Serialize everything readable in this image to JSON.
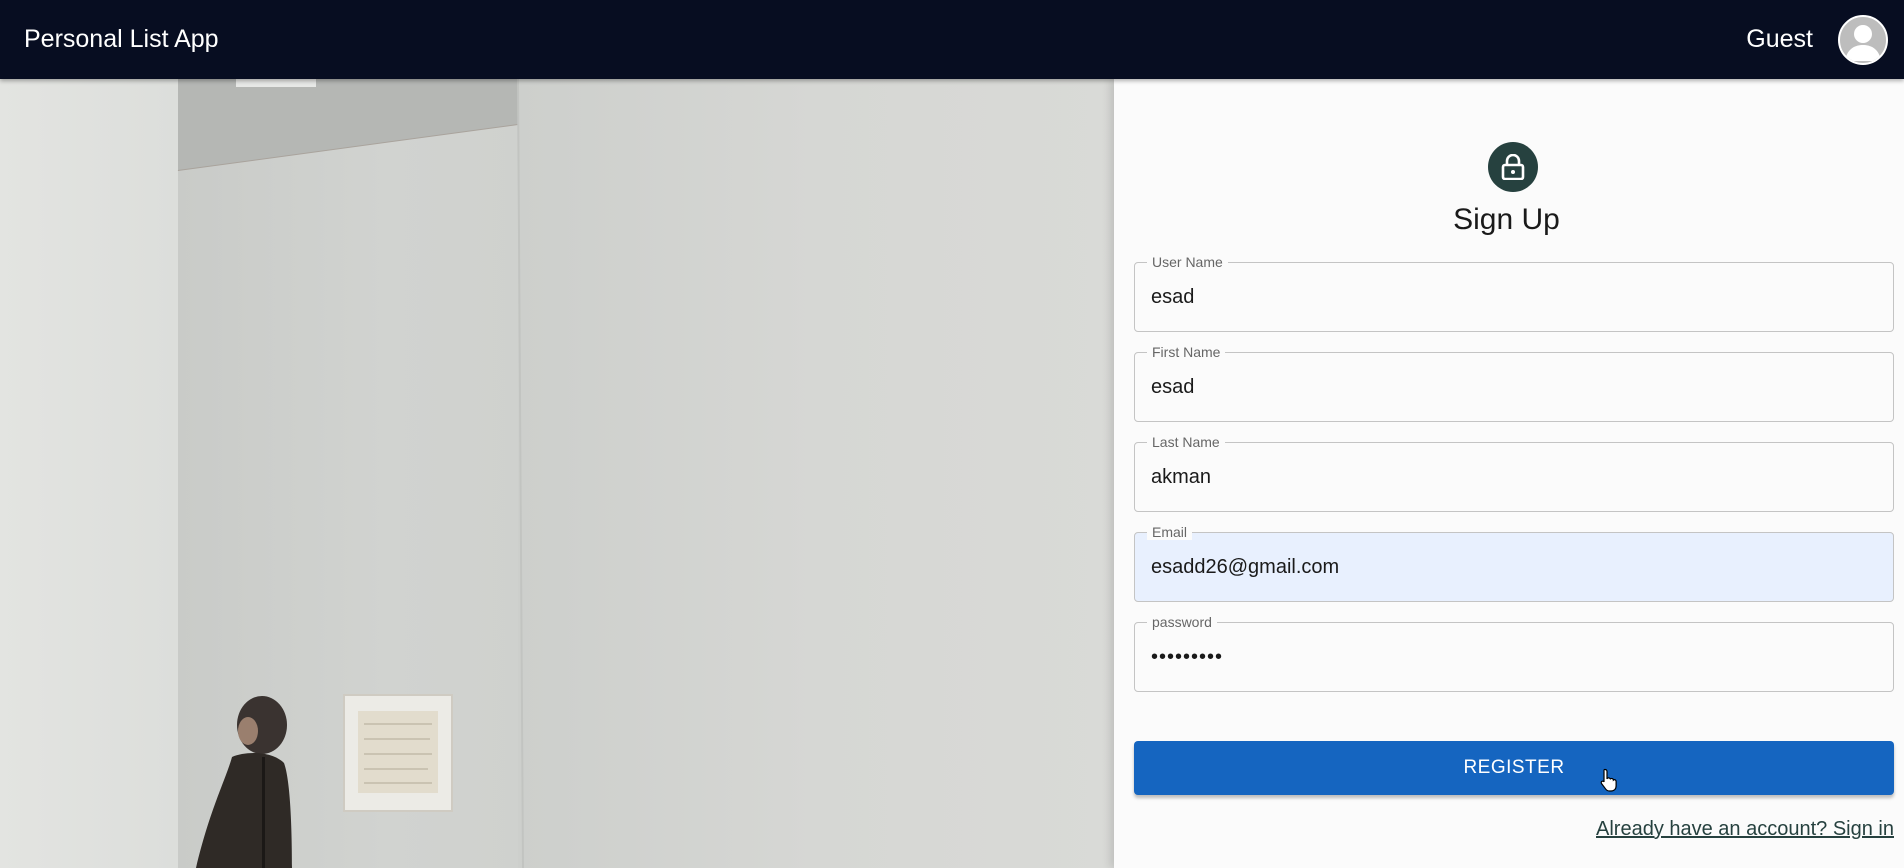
{
  "appbar": {
    "title": "Personal List App",
    "user_label": "Guest",
    "avatar_icon": "account-circle-icon",
    "background": "#070d21"
  },
  "hero": {
    "image": "gallery-wall-woman-photo"
  },
  "form": {
    "icon": "lock-icon",
    "title": "Sign Up",
    "fields": [
      {
        "label": "User Name",
        "value": "esad"
      },
      {
        "label": "First Name",
        "value": "esad"
      },
      {
        "label": "Last Name",
        "value": "akman"
      },
      {
        "label": "Email",
        "value": "esadd26@gmail.com"
      },
      {
        "label": "password",
        "value": "•••••••••"
      }
    ],
    "submit_label": "REGISTER",
    "signin_link": "Already have an account? Sign in"
  },
  "colors": {
    "primary": "#1565c0",
    "lock_avatar": "#26413f",
    "autofill": "#e8f0fe"
  }
}
